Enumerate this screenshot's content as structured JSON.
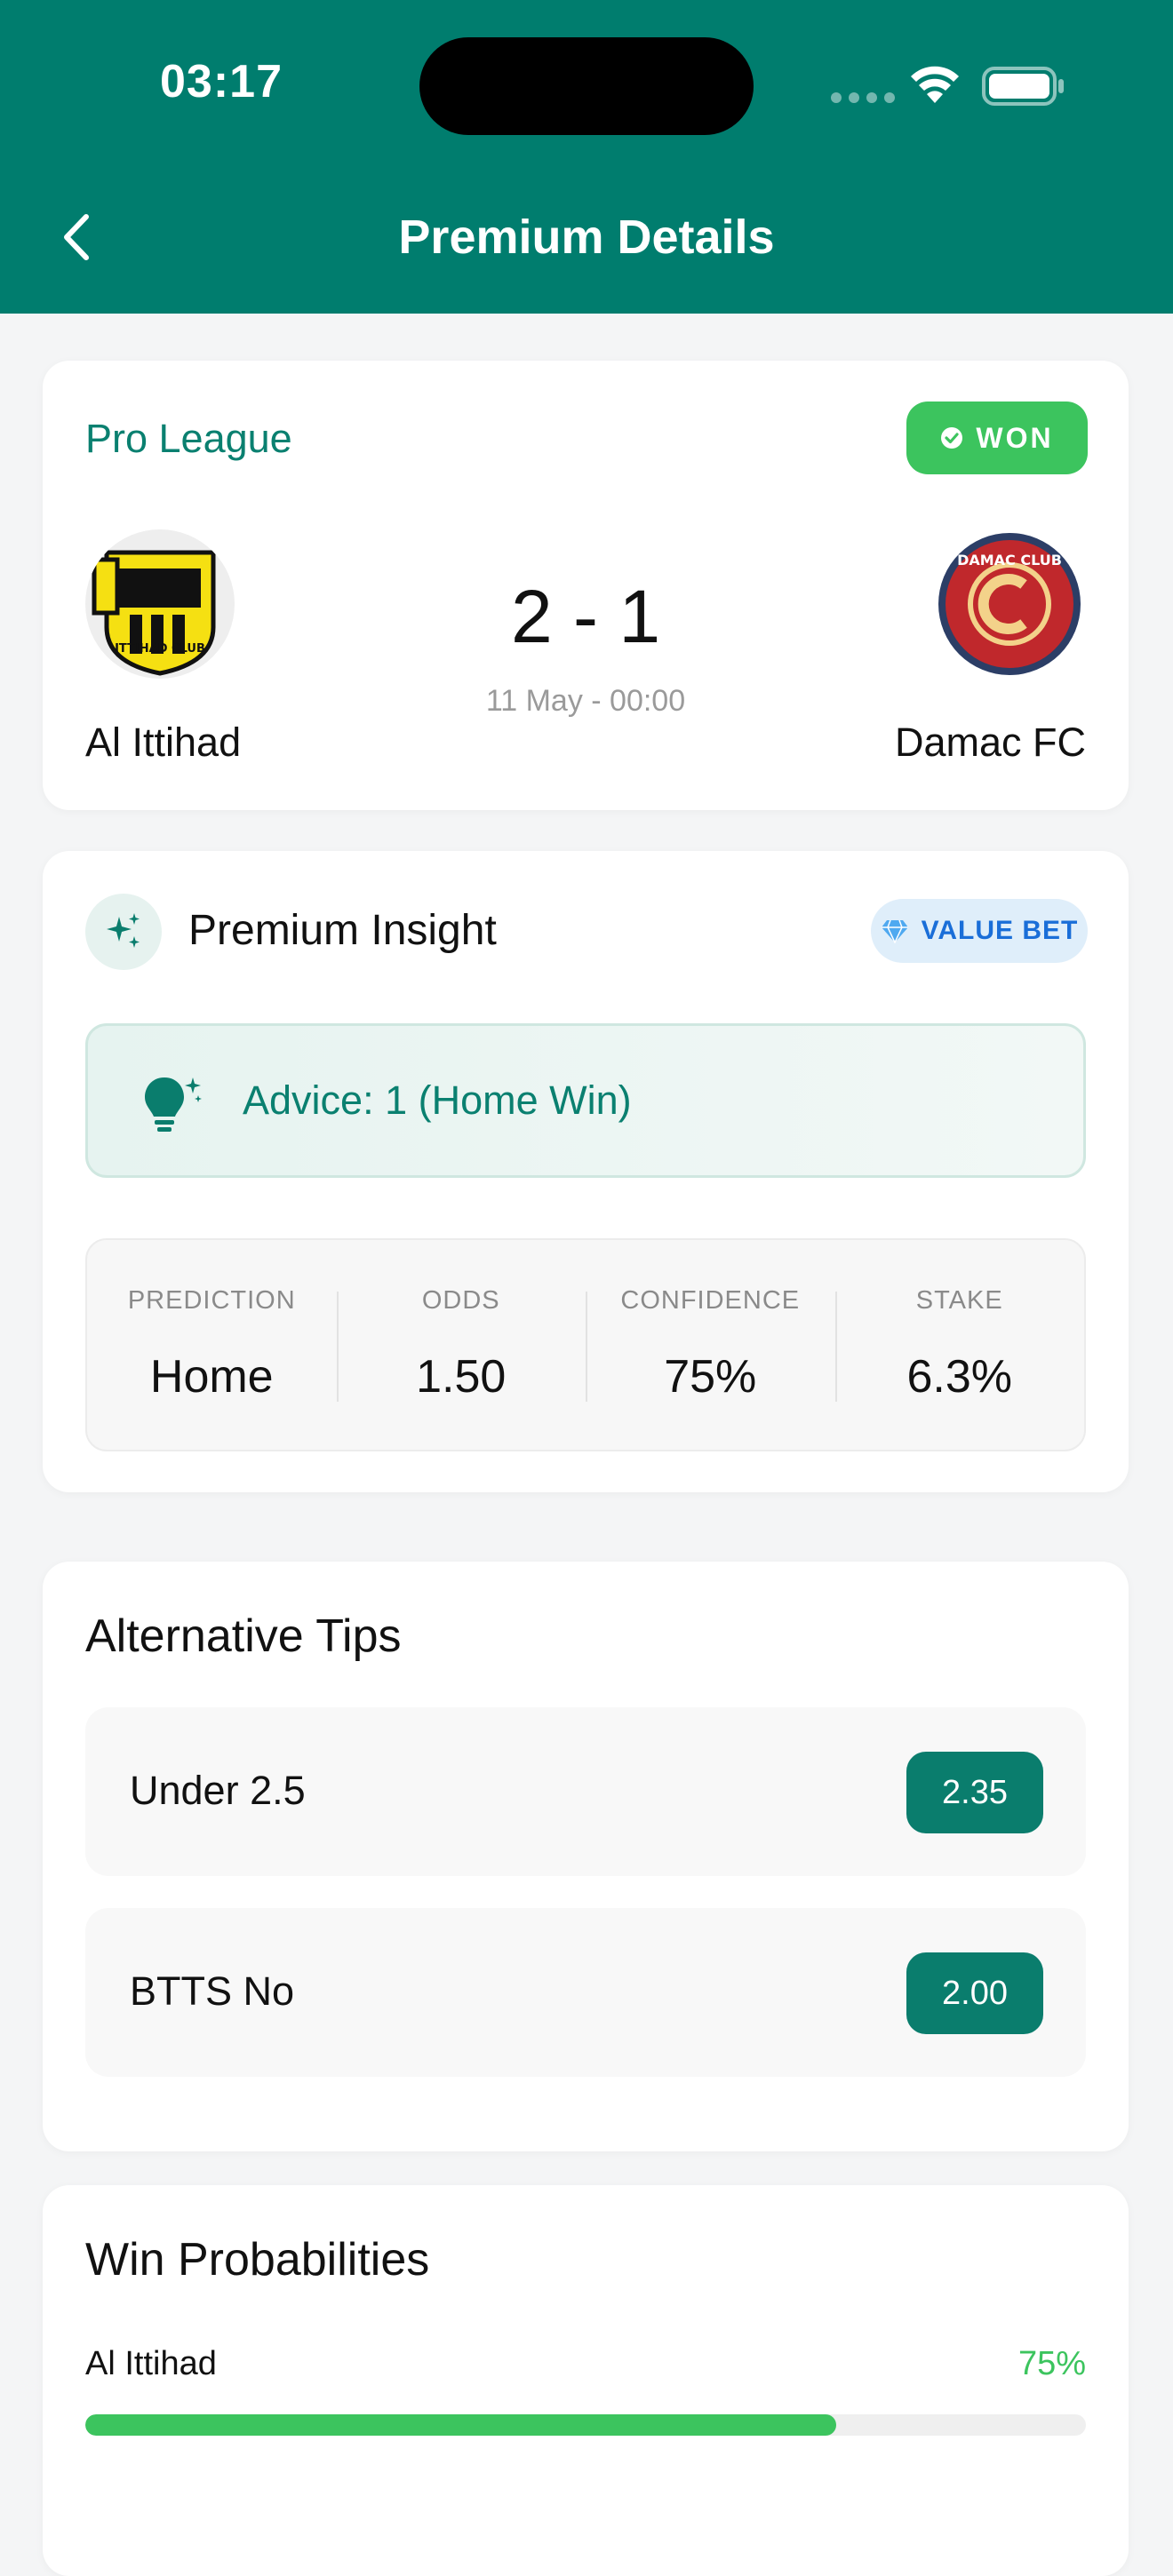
{
  "status_bar": {
    "time": "03:17"
  },
  "header": {
    "title": "Premium Details"
  },
  "match": {
    "league": "Pro League",
    "result_badge": "WON",
    "home_team": "Al Ittihad",
    "away_team": "Damac FC",
    "score": "2 - 1",
    "date": "11 May - 00:00",
    "home_logo_text": "ITTIHAD CLUB",
    "away_logo_text": "DAMAC CLUB"
  },
  "insight": {
    "title": "Premium Insight",
    "badge": "VALUE BET",
    "advice": "Advice: 1 (Home Win)",
    "stats": [
      {
        "label": "PREDICTION",
        "value": "Home"
      },
      {
        "label": "ODDS",
        "value": "1.50"
      },
      {
        "label": "CONFIDENCE",
        "value": "75%"
      },
      {
        "label": "STAKE",
        "value": "6.3%"
      }
    ]
  },
  "alternative_tips": {
    "title": "Alternative Tips",
    "tips": [
      {
        "label": "Under 2.5",
        "odds": "2.35"
      },
      {
        "label": "BTTS No",
        "odds": "2.00"
      }
    ]
  },
  "win_probabilities": {
    "title": "Win Probabilities",
    "items": [
      {
        "team": "Al Ittihad",
        "percent": "75%",
        "value": 0.75
      }
    ]
  },
  "colors": {
    "brand": "#007d6e",
    "success": "#3cc45e",
    "value_badge": "#1a6ed8"
  }
}
